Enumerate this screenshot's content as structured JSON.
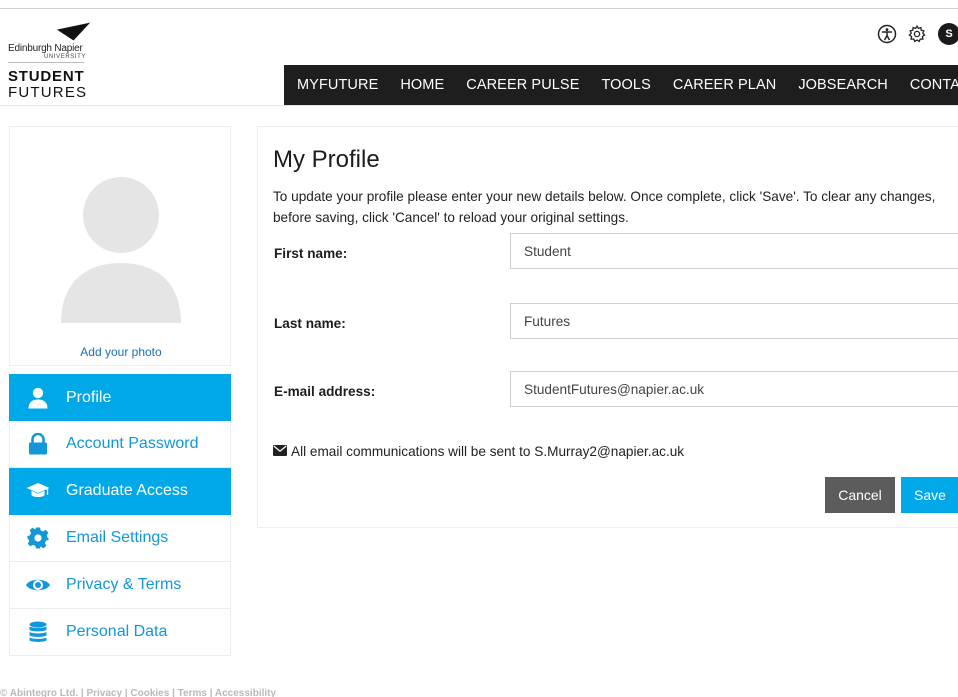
{
  "logo": {
    "university_line1": "Edinburgh Napier",
    "university_line2": "UNIVERSITY",
    "brand_line1": "STUDENT",
    "brand_line2": "FUTURES"
  },
  "header": {
    "user_initial": "S"
  },
  "nav": {
    "items": [
      "MYFUTURE",
      "HOME",
      "CAREER PULSE",
      "TOOLS",
      "CAREER PLAN",
      "JOBSEARCH",
      "CONTACT US"
    ]
  },
  "sidebar": {
    "add_photo_label": "Add your photo",
    "items": [
      {
        "label": "Profile",
        "icon": "user-icon",
        "active": true
      },
      {
        "label": "Account Password",
        "icon": "lock-icon",
        "active": false
      },
      {
        "label": "Graduate Access",
        "icon": "graduation-cap-icon",
        "active": true
      },
      {
        "label": "Email Settings",
        "icon": "gear-icon",
        "active": false
      },
      {
        "label": "Privacy & Terms",
        "icon": "eye-icon",
        "active": false
      },
      {
        "label": "Personal Data",
        "icon": "database-icon",
        "active": false
      }
    ]
  },
  "profile": {
    "title": "My Profile",
    "intro": "To update your profile please enter your new details below. Once complete, click 'Save'. To clear any changes, before saving, click 'Cancel' to reload your original settings.",
    "first_name_label": "First name:",
    "first_name_value": "Student",
    "last_name_label": "Last name:",
    "last_name_value": "Futures",
    "email_label": "E-mail address:",
    "email_value": "StudentFutures@napier.ac.uk",
    "email_note": "All email communications will be sent to S.Murray2@napier.ac.uk",
    "cancel_label": "Cancel",
    "save_label": "Save"
  },
  "footer": {
    "text": "© Abintegro Ltd. | Privacy | Cookies | Terms | Accessibility"
  },
  "colors": {
    "accent": "#00a8e8",
    "nav_bg": "#1e1e1e",
    "cancel_bg": "#5c5c5c",
    "link": "#1297d8"
  }
}
